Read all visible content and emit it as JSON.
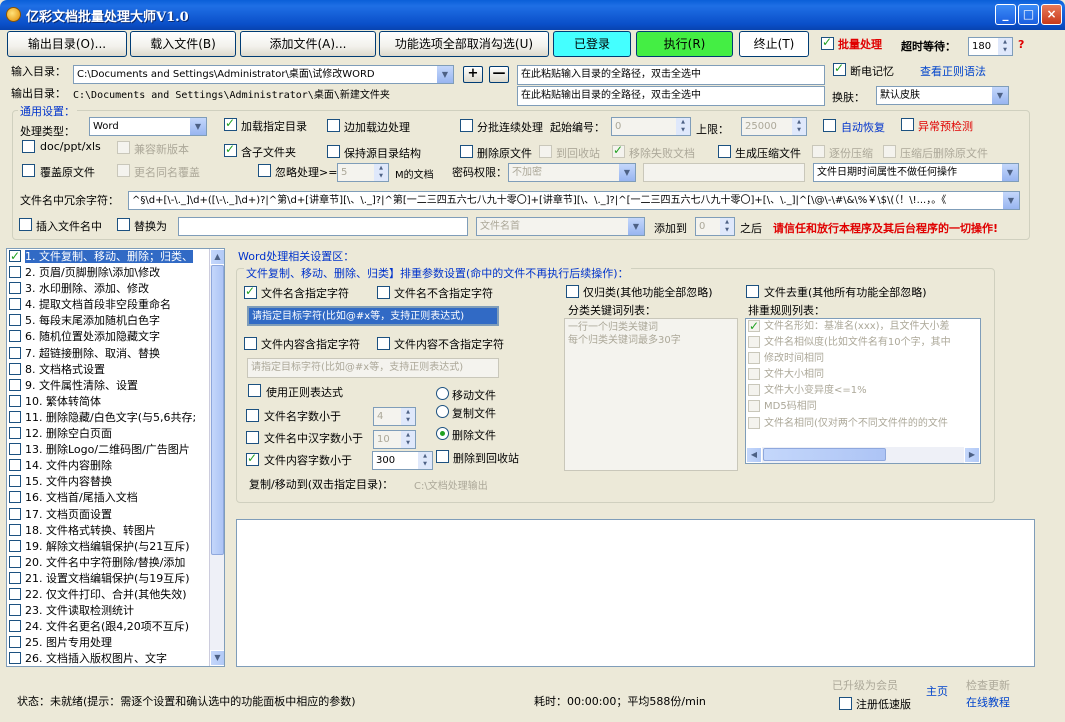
{
  "window": {
    "title": "亿彩文档批量处理大师V1.0",
    "min": "_",
    "max": "□",
    "close": "×"
  },
  "toolbar": {
    "output_dir": "输出目录(O)...",
    "load_file": "载入文件(B)",
    "add_file": "添加文件(A)...",
    "toggle_all": "功能选项全部取消勾选(U)",
    "logged_in": "已登录",
    "execute": "执行(R)",
    "stop": "终止(T)",
    "batch_label": "批量处理",
    "timeout_label": "超时等待：",
    "timeout_value": "180",
    "help": "?"
  },
  "dirs": {
    "input_label": "输入目录：",
    "input_value": "C:\\Documents and Settings\\Administrator\\桌面\\试修改WORD",
    "output_label": "输出目录：",
    "output_value": "C:\\Documents and Settings\\Administrator\\桌面\\新建文件夹",
    "plus": "+",
    "minus": "—",
    "paste_input": "在此粘贴输入目录的全路径，双击全选中",
    "paste_output": "在此粘贴输出目录的全路径，双击全选中",
    "resume_label": "断电记忆",
    "regex_link": "查看正则语法",
    "skin_label": "换肤：",
    "skin_value": "默认皮肤"
  },
  "general": {
    "title": "通用设置：",
    "type_label": "处理类型：",
    "type_value": "Word",
    "load_dir": "加载指定目录",
    "load_while": "边加载边处理",
    "batch_cont": "分批连续处理",
    "start_no_label": "起始编号：",
    "start_no_value": "0",
    "upper_label": "上限：",
    "upper_value": "25000",
    "auto_recover": "自动恢复",
    "pre_check": "异常预检测",
    "doc_ppt_xls": "doc/ppt/xls",
    "compat": "兼容新版本",
    "subfolder": "含子文件夹",
    "keep_struct": "保持源目录结构",
    "del_orig": "删除原文件",
    "to_recycle": "到回收站",
    "move_failed": "移除失败文档",
    "gen_zip": "生成压缩文件",
    "split_zip": "逐份压缩",
    "del_after_zip": "压缩后删除原文件",
    "overwrite": "覆盖原文件",
    "rename_same": "更名同名覆盖",
    "ignore_label": "忽略处理>=",
    "ignore_value": "5",
    "ignore_unit": "M的文档",
    "pwd_label": "密码权限：",
    "pwd_value": "不加密",
    "date_attr": "文件日期时间属性不做任何操作",
    "redundant_label": "文件名中冗余字符：",
    "redundant_value": "^§\\d+[\\-\\._]\\d+([\\-\\._]\\d+)?|^第\\d+[讲章节][\\、\\._]?|^第[一二三四五六七八九十零〇]+[讲章节][\\、\\._]?|^[一二三四五六七八九十零〇]+[\\、\\._]|^[\\@\\-\\#\\&\\%￥\\$\\(（！\\!...，。《",
    "insert_name": "插入文件名中",
    "replace_as": "替换为",
    "name_head": "文件名首",
    "add_to_label": "添加到",
    "add_to_value": "0",
    "after_label": "之后",
    "trust_warning": "请信任和放行本程序及其后台程序的一切操作!"
  },
  "functions": [
    {
      "label": "1. 文件复制、移动、删除；归类、",
      "checked": true,
      "selected": true
    },
    {
      "label": "2. 页眉/页脚删除\\添加\\修改",
      "checked": false
    },
    {
      "label": "3. 水印删除、添加、修改",
      "checked": false
    },
    {
      "label": "4. 提取文档首段非空段重命名",
      "checked": false
    },
    {
      "label": "5. 每段末尾添加随机白色字",
      "checked": false
    },
    {
      "label": "6. 随机位置处添加隐藏文字",
      "checked": false
    },
    {
      "label": "7. 超链接删除、取消、替换",
      "checked": false
    },
    {
      "label": "8. 文档格式设置",
      "checked": false
    },
    {
      "label": "9. 文件属性清除、设置",
      "checked": false
    },
    {
      "label": "10. 繁体转简体",
      "checked": false
    },
    {
      "label": "11. 删除隐藏/白色文字(与5,6共存;",
      "checked": false
    },
    {
      "label": "12. 删除空白页面",
      "checked": false
    },
    {
      "label": "13. 删除Logo/二维码图/广告图片",
      "checked": false
    },
    {
      "label": "14. 文件内容删除",
      "checked": false
    },
    {
      "label": "15. 文件内容替换",
      "checked": false
    },
    {
      "label": "16. 文档首/尾插入文档",
      "checked": false
    },
    {
      "label": "17. 文档页面设置",
      "checked": false
    },
    {
      "label": "18. 文件格式转换、转图片",
      "checked": false
    },
    {
      "label": "19. 解除文档编辑保护(与21互斥)",
      "checked": false
    },
    {
      "label": "20. 文件名中字符删除/替换/添加",
      "checked": false
    },
    {
      "label": "21. 设置文档编辑保护(与19互斥)",
      "checked": false
    },
    {
      "label": "22. 仅文件打印、合并(其他失效)",
      "checked": false
    },
    {
      "label": "23. 文件读取检测统计",
      "checked": false
    },
    {
      "label": "24. 文件名更名(跟4,20项不互斥)",
      "checked": false
    },
    {
      "label": "25. 图片专用处理",
      "checked": false
    },
    {
      "label": "26. 文档插入版权图片、文字",
      "checked": false
    }
  ],
  "word": {
    "title": "Word处理相关设置区：",
    "sub_title": "文件复制、移动、删除、归类】排重参数设置(命中的文件不再执行后续操作)：",
    "name_contains": "文件名含指定字符",
    "name_not_contains": "文件名不含指定字符",
    "target_placeholder": "请指定目标字符(比如@#x等，支持正则表达式)",
    "content_contains": "文件内容含指定字符",
    "content_not_contains": "文件内容不含指定字符",
    "target_placeholder2": "请指定目标字符(比如@#x等，支持正则表达式)",
    "use_regex": "使用正则表达式",
    "move_file": "移动文件",
    "copy_file": "复制文件",
    "delete_file": "删除文件",
    "name_len_label": "文件名字数小于",
    "name_len_value": "4",
    "name_cn_label": "文件名中汉字数小于",
    "name_cn_value": "10",
    "content_len_label": "文件内容字数小于",
    "content_len_value": "300",
    "del_to_recycle": "删除到回收站",
    "copy_to_label": "复制/移动到(双击指定目录)：",
    "copy_to_value": "C:\\文档处理输出",
    "only_classify": "仅归类(其他功能全部忽略)",
    "classify_list": "分类关键词列表：",
    "classify_hint": "一行一个归类关键词\n每个归类关键词最多30字",
    "dedupe": "文件去重(其他所有功能全部忽略)",
    "rule_list_label": "排重规则列表：",
    "rules": [
      {
        "label": "文件名形如：基准名(xxx)，且文件大小差",
        "checked": true
      },
      {
        "label": "文件名相似度(比如文件名有10个字，其中",
        "checked": false
      },
      {
        "label": "修改时间相同",
        "checked": false
      },
      {
        "label": "文件大小相同",
        "checked": false
      },
      {
        "label": "文件大小变异度<=1%",
        "checked": false
      },
      {
        "label": "MD5码相同",
        "checked": false
      },
      {
        "label": "文件名相同(仅对两个不同文件件的的文件",
        "checked": false
      }
    ]
  },
  "status": {
    "text": "状态：未就绪(提示：需逐个设置和确认选中的功能面板中相应的参数)",
    "time": "耗时：00:00:00；平均588份/min",
    "upgraded": "已升级为会员",
    "check_update": "检查更新",
    "register_slow": "注册低速版",
    "home": "主页",
    "tutorial": "在线教程"
  },
  "colors": {
    "accent_red": "#e00000",
    "accent_blue": "#0033cc",
    "login_bg": "#44ffff",
    "exec_bg": "#44ee44"
  }
}
